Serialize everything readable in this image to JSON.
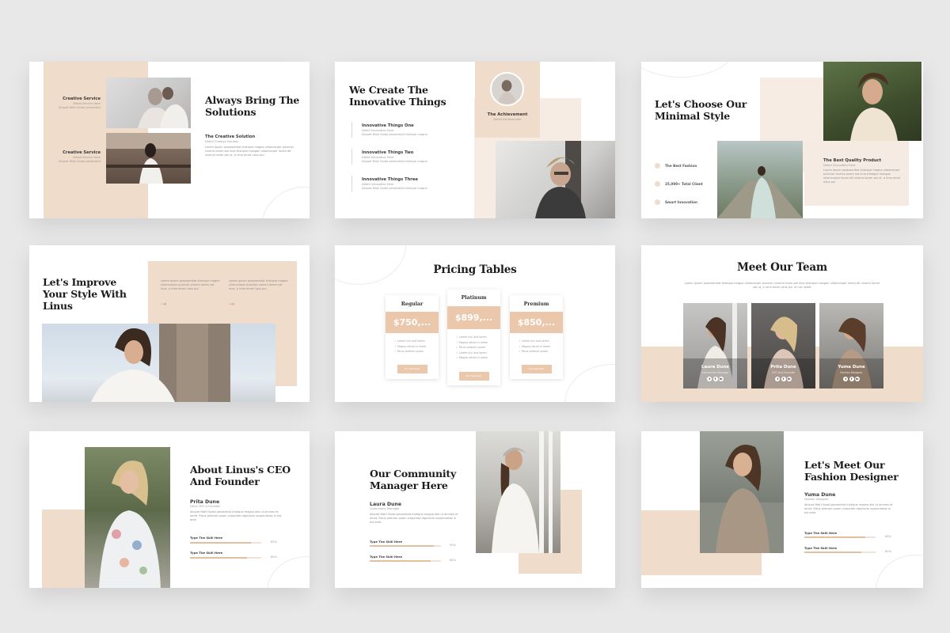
{
  "slides": [
    {
      "title": "Always Bring The Solutions",
      "services": [
        {
          "heading": "Creative Service",
          "sub": "Detail Service Here",
          "text": "Aliquet Nibh Sodal pessentiat"
        },
        {
          "heading": "Creative Service",
          "sub": "Detail Service Here",
          "text": "Aliquet Nibh Sodal pessentiat"
        }
      ],
      "solution_heading": "The Creative Solution",
      "solution_sub": "Detail Creative Solution",
      "body": "Lorem ipsum prosesentiat tristique magna ullamcorper pulvinar viverra lorem sat inna tristique mangan ullamcorper lorem dit viverra lorem sat ut, a rimo emet riaus pur"
    },
    {
      "title": "We Create The Innovative Things",
      "items": [
        {
          "heading": "Innovative Things One",
          "sub": "Detail Innovative Here",
          "text": "Aliquet Nibh Sodal pessentiat tristique magna"
        },
        {
          "heading": "Innovative Things Two",
          "sub": "Detail Innovative Here",
          "text": "Aliquet Nibh Sodal pessentiat tristique magna"
        },
        {
          "heading": "Innovative Things Three",
          "sub": "Detail Innovative Here",
          "text": "Aliquet Nibh Sodal pessentiat tristique magna"
        }
      ],
      "achievement": "The Achievement",
      "achievement_sub": "Detail Achievement"
    },
    {
      "title": "Let's Choose Our Minimal Style",
      "bullets": [
        "The Best Fashion",
        "25,000+ Total Client",
        "Smart Innovation"
      ],
      "product_heading": "The Best Quality Product",
      "product_sub": "Detail Innovation Here",
      "body": "Lorem ipsum prosesentiat tristique magna ullamcorper pulvinar viverra lorem sat inna tristique mangan ullamcorper lorem dit viverra lorem sat ut, a rimo emet riaus pur"
    },
    {
      "title": "Let's Improve Your Style With Linus",
      "col1": "Lorem ipsum prosesentiat tristique magna ullamcorper pulvinar viverra lorem sat inna, a rimo emet riaus pur",
      "col2": "Lorem ipsum prosesentiat tristique magna ullamcorper pulvinar viverra lorem sat inna, a rimo emet riaus pur",
      "arrow": "→"
    },
    {
      "title": "Pricing Tables",
      "plans": [
        {
          "name": "Regular",
          "price": "$750,...",
          "features": [
            "Lorem nisi iaut lorem",
            "Magna ultrad ni lorem",
            "Risus pretium quam"
          ],
          "button": "Purchase Now"
        },
        {
          "name": "Platinum",
          "price": "$899,...",
          "features": [
            "Lorem nisi iaut lorem",
            "Magna ultrad ni lorem",
            "Risus pretium quam",
            "Lorem nisi iaut lorem",
            "Magna ultrad ni lorem"
          ],
          "button": "Purchase Now"
        },
        {
          "name": "Premium",
          "price": "$850,...",
          "features": [
            "Lorem nisi iaut lorem",
            "Magna ultrad ni lorem",
            "Risus pretium quam"
          ],
          "button": "Purchase Now"
        }
      ]
    },
    {
      "title": "Meet Our Team",
      "intro": "Lorem ipsum prosesentiat tristique magna ullamcorper pulvinar viverra lorem sat inna tristique mangan ullamcorper lorem dit viverra lorem sat ut, a rimo emet riaus pur ut nisi ueltet",
      "members": [
        {
          "name": "Laura Dune",
          "role": "Community Manager"
        },
        {
          "name": "Prita Dune",
          "role": "CEO And Founder"
        },
        {
          "name": "Yuma Dune",
          "role": "Fashion Designer"
        }
      ],
      "social": [
        "t",
        "f",
        "in"
      ]
    },
    {
      "title": "About Linus's CEO And Founder",
      "name": "Prita Dune",
      "role": "Linus CEO & Founder",
      "body": "Aliquet NibH Sodal pessentiat tristique magna alle ut amnies et emet. Risus pretium quam vulputate dignissim suspendisse in est ante",
      "skills": [
        {
          "label": "Type The Skill Here",
          "value": 85
        },
        {
          "label": "Type The Skill Here",
          "value": 80
        }
      ]
    },
    {
      "title": "Our Community Manager Here",
      "name": "Laura Dune",
      "role": "Community Manager",
      "body": "Aliquet NibH Sodal pessentiat tristique magna alle ut amnies et emet. Risus pretium quam vulputate dignissim suspendisse in est ante",
      "skills": [
        {
          "label": "Type The Skill Here",
          "value": 90
        },
        {
          "label": "Type The Skill Here",
          "value": 85
        }
      ]
    },
    {
      "title": "Let's Meet Our Fashion Designer",
      "name": "Yuma Dune",
      "role": "Fashion Designer",
      "body": "Aliquet NibH Sodal pessentiat tristique magna alle ut amnies et emet. Risus pretium quam vulputate dignissim suspendisse in est ante",
      "skills": [
        {
          "label": "Type The Skill Here",
          "value": 85
        },
        {
          "label": "Type The Skill Here",
          "value": 80
        }
      ]
    }
  ],
  "colors": {
    "background": "#e8e8e8",
    "accent": "#f0dccb",
    "accent_dark": "#ebc8ab"
  }
}
